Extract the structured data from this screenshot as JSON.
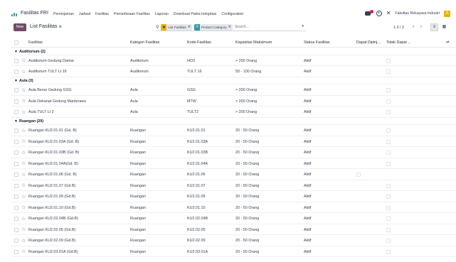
{
  "nav": {
    "brand": "Fasilitas FRI",
    "menu": [
      "Peminjaman",
      "Jadwal",
      "Fasilitas",
      "Pemeriksaan Fasilitas",
      "Laporan",
      "Download Pakta Integritas",
      "Configuration"
    ],
    "company": "Fakultas Rekayasa Industri",
    "avatar_letter": "A",
    "tools_glyph": "✕"
  },
  "control": {
    "new_label": "New",
    "title": "List Fasilitas",
    "facets": [
      {
        "icon": "★",
        "label": "List Fasilitas",
        "color": "#eab308"
      },
      {
        "icon": "≡",
        "label": "Product Category",
        "color": "#2f9aa6"
      }
    ],
    "search_placeholder": "Search...",
    "pager": "1-3 / 3"
  },
  "columns": {
    "name": "Fasilitas",
    "cat": "Kategori Fasilitas",
    "kode": "Kode Fasilitas",
    "kap": "Kapasitas Maksimum",
    "stat": "Status Fasilitas",
    "dap": "Dapat Dipinj...",
    "tdk": "Tidak Dapat ..."
  },
  "groups": [
    {
      "label": "Auditorium (2)",
      "rows": [
        {
          "name": "Auditorium Gedung Damar",
          "cat": "Auditorium",
          "kode": "HO2",
          "kap": "> 200 Orang",
          "stat": "Aktif",
          "dap": true,
          "tdk": false
        },
        {
          "name": "Auditorium TULT Lt 16",
          "cat": "Auditorium",
          "kode": "TULT 16",
          "kap": "50 - 100 Orang",
          "stat": "Aktif",
          "dap": true,
          "tdk": false
        }
      ]
    },
    {
      "label": "Aula (3)",
      "rows": [
        {
          "name": "Aula Besar Gedung GSG",
          "cat": "Aula",
          "kode": "GSG",
          "kap": "> 200 Orang",
          "stat": "Aktif",
          "dap": true,
          "tdk": false
        },
        {
          "name": "Aula Dekanat Gedung Manterawu",
          "cat": "Aula",
          "kode": "MTW",
          "kap": "> 200 Orang",
          "stat": "Aktif",
          "dap": true,
          "tdk": false
        },
        {
          "name": "Aula TULT Lt 2",
          "cat": "Aula",
          "kode": "TULT2",
          "kap": "> 200 Orang",
          "stat": "Aktif",
          "dap": true,
          "tdk": false
        }
      ]
    },
    {
      "label": "Ruangan (29)",
      "rows": [
        {
          "name": "Ruangan KU2.01.01 (Gd. B)",
          "cat": "Ruangan",
          "kode": "KU2.01.01",
          "kap": "20 - 50 Orang",
          "stat": "Aktif",
          "dap": true,
          "tdk": false
        },
        {
          "name": "Ruangan KU2.01.03A (Gd. B)",
          "cat": "Ruangan",
          "kode": "KU2.01.03A",
          "kap": "20 - 50 Orang",
          "stat": "Aktif",
          "dap": true,
          "tdk": false
        },
        {
          "name": "Ruangan KU2.01.03B (Gd. B)",
          "cat": "Ruangan",
          "kode": "KU2.01.03B",
          "kap": "20 - 50 Orang",
          "stat": "Aktif",
          "dap": true,
          "tdk": false
        },
        {
          "name": "Ruangan KU2.01.04A(Gd. B)",
          "cat": "Ruangan",
          "kode": "KU2.01.04A",
          "kap": "20 - 50 Orang",
          "stat": "Aktif",
          "dap": true,
          "tdk": false
        },
        {
          "name": "Ruangan KU2.01.06 (Gd. B)",
          "cat": "Ruangan",
          "kode": "KU2.01.06",
          "kap": "20 - 50 Orang",
          "stat": "Aktif",
          "dap": false,
          "tdk": true
        },
        {
          "name": "Ruangan KU2.01.07 (Gd.B)",
          "cat": "Ruangan",
          "kode": "KU2.01.07",
          "kap": "20 - 50 Orang",
          "stat": "Aktif",
          "dap": true,
          "tdk": false
        },
        {
          "name": "Ruangan KU2.01.09 (Gd.B)",
          "cat": "Ruangan",
          "kode": "KU2.01.09",
          "kap": "20 - 50 Orang",
          "stat": "Aktif",
          "dap": true,
          "tdk": false
        },
        {
          "name": "Ruangan KU2.01.10 (Gd.B)",
          "cat": "Ruangan",
          "kode": "KU2.01.10",
          "kap": "20 - 50 Orang",
          "stat": "Aktif",
          "dap": true,
          "tdk": false
        },
        {
          "name": "Ruangan KU2.02.04B (Gd.B)",
          "cat": "Ruangan",
          "kode": "KU2.02.04B",
          "kap": "20 - 50 Orang",
          "stat": "Aktif",
          "dap": true,
          "tdk": false
        },
        {
          "name": "Ruangan KU2.02.05 (Gd.B)",
          "cat": "Ruangan",
          "kode": "KU2.02.05",
          "kap": "20 - 50 Orang",
          "stat": "Aktif",
          "dap": true,
          "tdk": false
        },
        {
          "name": "Ruangan KU2.02.09 (Gd.B)",
          "cat": "Ruangan",
          "kode": "KU2.02.09",
          "kap": "20 - 50 Orang",
          "stat": "Aktif",
          "dap": true,
          "tdk": false
        },
        {
          "name": "Ruangan KU2.03.01A (Gd.B)",
          "cat": "Ruangan",
          "kode": "KU2.03.01A",
          "kap": "20 - 50 Orang",
          "stat": "Aktif",
          "dap": true,
          "tdk": false
        }
      ]
    }
  ]
}
